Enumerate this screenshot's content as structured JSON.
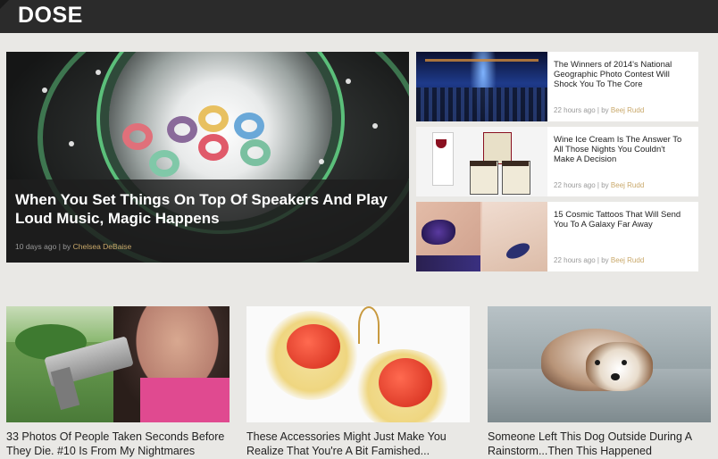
{
  "header": {
    "logo": "DOSE"
  },
  "hero": {
    "title": "When You Set Things On Top Of Speakers And Play Loud Music, Magic Happens",
    "time": "10 days ago",
    "separator": " | by ",
    "author": "Chelsea DeBaise"
  },
  "side": [
    {
      "title": "The Winners of 2014's National Geographic Photo Contest Will Shock You To The Core",
      "time": "22 hours ago",
      "separator": " | by ",
      "author": "Beej Rudd"
    },
    {
      "title": "Wine Ice Cream Is The Answer To All Those Nights You Couldn't Make A Decision",
      "time": "22 hours ago",
      "separator": " | by ",
      "author": "Beej Rudd"
    },
    {
      "title": "15 Cosmic Tattoos That Will Send You To A Galaxy Far Away",
      "time": "22 hours ago",
      "separator": " | by ",
      "author": "Beej Rudd"
    }
  ],
  "bottom": [
    {
      "title": "33 Photos Of People Taken Seconds Before They Die. #10 Is From My Nightmares"
    },
    {
      "title": "These Accessories Might Just Make You Realize That You're A Bit Famished..."
    },
    {
      "title": "Someone Left This Dog Outside During A Rainstorm...Then This Happened"
    }
  ],
  "colors": {
    "header_bg": "#2b2b2b",
    "author_link": "#c9a86a",
    "page_bg": "#e9e8e5"
  }
}
